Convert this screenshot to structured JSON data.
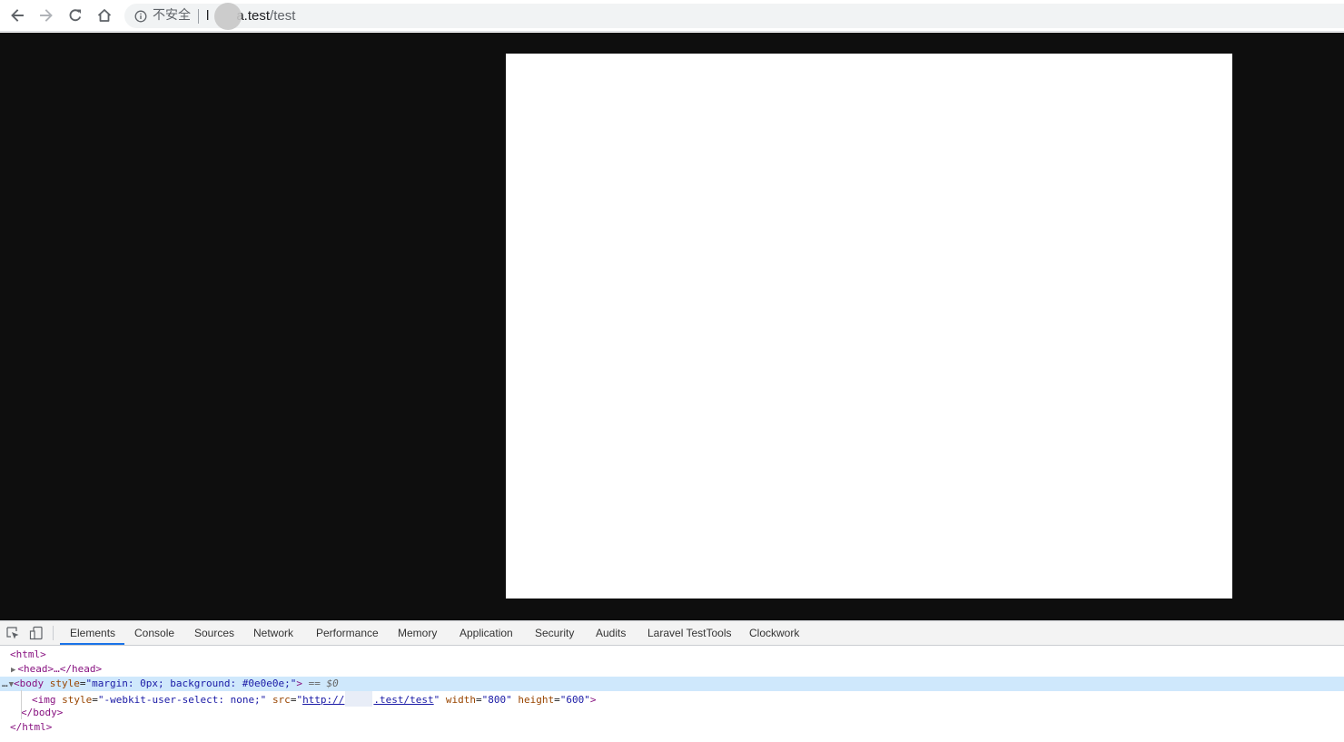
{
  "browser": {
    "security_label": "不安全",
    "url_host_prefix": "l",
    "url_host_rest": "a.test",
    "url_path": "/test"
  },
  "devtools": {
    "tabs": [
      {
        "label": "Elements",
        "active": true
      },
      {
        "label": "Console"
      },
      {
        "label": "Sources"
      },
      {
        "label": "Network"
      },
      {
        "label": "Performance"
      },
      {
        "label": "Memory"
      },
      {
        "label": "Application"
      },
      {
        "label": "Security"
      },
      {
        "label": "Audits"
      },
      {
        "label": "Laravel TestTools"
      },
      {
        "label": "Clockwork"
      }
    ],
    "dom": {
      "html_open": "<html>",
      "head_collapsed": "<head>…</head>",
      "body_open_tag": "<body",
      "body_style_attr": "style",
      "body_style_value": "\"margin: 0px; background: #0e0e0e;\"",
      "body_close_bracket": ">",
      "selected_marker": "== $0",
      "img_open": "<img",
      "img_style_attr": "style",
      "img_style_value": "\"-webkit-user-select: none;\"",
      "img_src_attr": "src",
      "img_src_prefix": "http://",
      "img_src_suffix": ".test/test",
      "img_width_attr": "width",
      "img_width_value": "\"800\"",
      "img_height_attr": "height",
      "img_height_value": "\"600\"",
      "img_close": ">",
      "body_close": "</body>",
      "html_close": "</html>"
    }
  },
  "colors": {
    "page_background": "#0e0e0e",
    "image_fill": "#ffffff",
    "selection": "#cfe8fc",
    "active_tab": "#1a73e8"
  },
  "icons": [
    "back-arrow-icon",
    "forward-arrow-icon",
    "reload-icon",
    "home-icon",
    "info-icon",
    "inspect-element-icon",
    "device-toolbar-icon"
  ]
}
